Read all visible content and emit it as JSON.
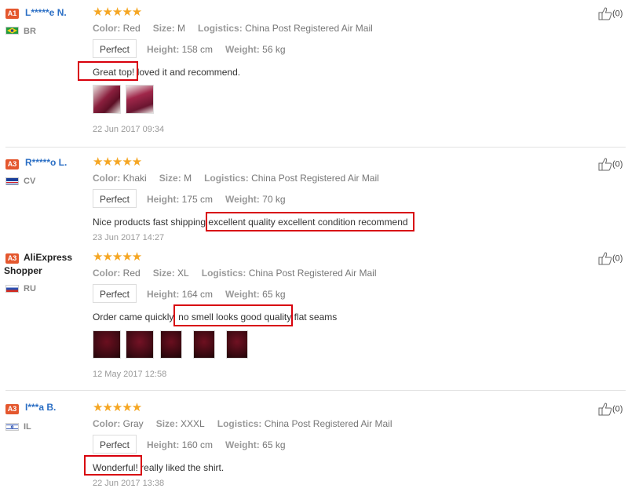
{
  "labels": {
    "color": "Color:",
    "size": "Size:",
    "logistics": "Logistics:",
    "height": "Height:",
    "weight": "Weight:"
  },
  "reviews": [
    {
      "badge": "A1",
      "badge_color": "#e4572e",
      "user": "L*****e N.",
      "country": "BR",
      "rating": 5,
      "color": "Red",
      "size": "M",
      "logistics": "China Post Registered Air Mail",
      "fit": "Perfect",
      "height": "158 cm",
      "weight": "56 kg",
      "highlight": "Great top!",
      "rest": " loved it and recommend.",
      "date": "22 Jun 2017 09:34",
      "likes": "(0)"
    },
    {
      "badge": "A3",
      "badge_color": "#e4572e",
      "user": "R*****o L.",
      "country": "CV",
      "rating": 5,
      "color": "Khaki",
      "size": "M",
      "logistics": "China Post Registered Air Mail",
      "fit": "Perfect",
      "height": "175 cm",
      "weight": "70 kg",
      "prefix": "Nice products fast shipping ",
      "highlight": "excellent quality excellent condition recommend",
      "date": "23 Jun 2017 14:27",
      "likes": "(0)"
    },
    {
      "badge": "A3",
      "badge_color": "#e4572e",
      "user_line1": "AliExpress",
      "user_line2": "Shopper",
      "country": "RU",
      "rating": 5,
      "color": "Red",
      "size": "XL",
      "logistics": "China Post Registered Air Mail",
      "fit": "Perfect",
      "height": "164 cm",
      "weight": "65 kg",
      "prefix": "Order came quickly. ",
      "highlight": "no smell looks good quality",
      "rest": " flat seams",
      "date": "12 May 2017 12:58",
      "likes": "(0)"
    },
    {
      "badge": "A3",
      "badge_color": "#e4572e",
      "user": "I***a B.",
      "country": "IL",
      "rating": 5,
      "color": "Gray",
      "size": "XXXL",
      "logistics": "China Post Registered Air Mail",
      "fit": "Perfect",
      "height": "160 cm",
      "weight": "65 kg",
      "highlight": "Wonderful!",
      "rest": " really liked the shirt.",
      "date": "22 Jun 2017 13:38",
      "likes": "(0)"
    }
  ],
  "colors": {
    "username": "#2a6ec4",
    "star": "#f5a623",
    "highlight_box": "#d8000c"
  }
}
